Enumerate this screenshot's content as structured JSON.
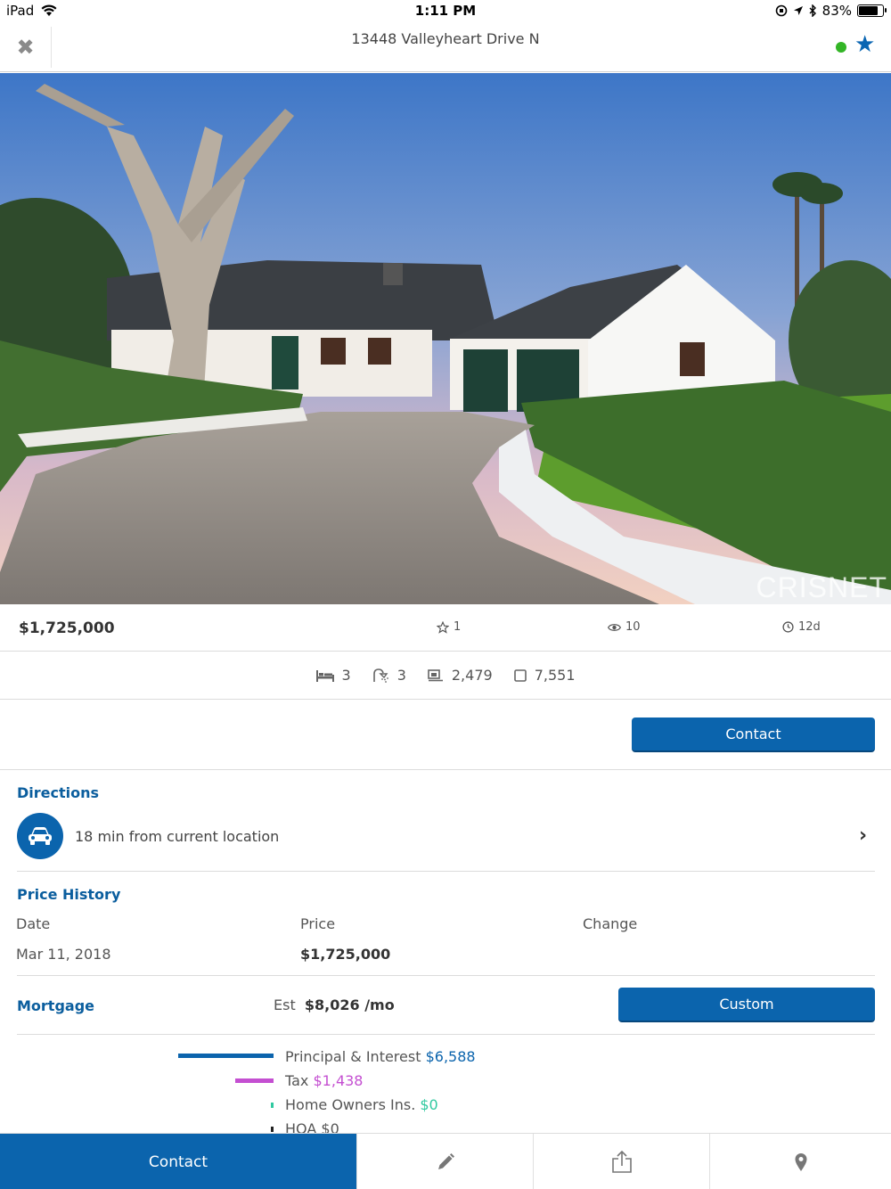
{
  "status_bar": {
    "device": "iPad",
    "time": "1:11 PM",
    "battery": "83%",
    "battery_level": 0.83
  },
  "header": {
    "title": "13448 Valleyheart Drive N",
    "status_dot_color": "#33b526",
    "favorite_icon": "star-filled-icon"
  },
  "photo": {
    "watermark": "CRISNET"
  },
  "stats": {
    "price": "$1,725,000",
    "favorites": "1",
    "views": "10",
    "days": "12d"
  },
  "features": {
    "beds": "3",
    "baths": "3",
    "sqft": "2,479",
    "lot": "7,551"
  },
  "contact_button": "Contact",
  "directions": {
    "title": "Directions",
    "text": "18 min from current location"
  },
  "price_history": {
    "title": "Price History",
    "headers": [
      "Date",
      "Price",
      "Change"
    ],
    "rows": [
      {
        "date": "Mar 11, 2018",
        "price": "$1,725,000",
        "change": ""
      }
    ]
  },
  "mortgage": {
    "title": "Mortgage",
    "est_label": "Est",
    "est_value": "$8,026 /mo",
    "custom_button": "Custom",
    "breakdown": [
      {
        "label": "Principal & Interest",
        "value": "$6,588",
        "color": "#0b64ad"
      },
      {
        "label": "Tax",
        "value": "$1,438",
        "color": "#c44fd1"
      },
      {
        "label": "Home Owners Ins.",
        "value": "$0",
        "color": "#2fc9a0"
      },
      {
        "label": "HOA",
        "value": "$0",
        "color": "#222222"
      }
    ]
  },
  "toolbar": {
    "contact": "Contact"
  },
  "colors": {
    "accent": "#0b64ad",
    "section_title": "#0b5e9e"
  }
}
